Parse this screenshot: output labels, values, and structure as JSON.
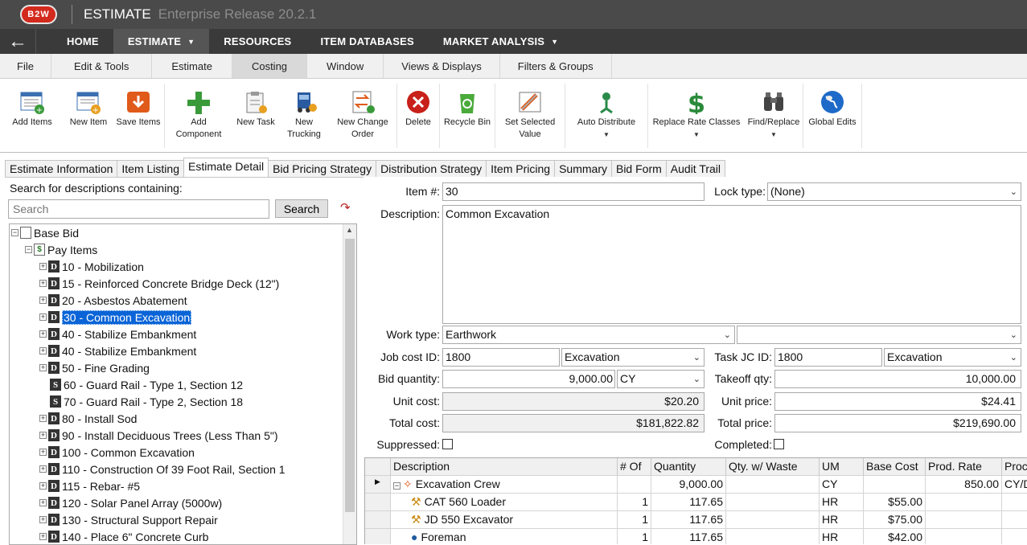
{
  "app": {
    "logo": "B2W",
    "title": "ESTIMATE",
    "release": "Enterprise Release 20.2.1"
  },
  "nav": {
    "home": "HOME",
    "estimate": "ESTIMATE",
    "resources": "RESOURCES",
    "item_db": "ITEM DATABASES",
    "market": "MARKET ANALYSIS"
  },
  "menu": [
    "File",
    "Edit & Tools",
    "Estimate",
    "Costing",
    "Window",
    "Views & Displays",
    "Filters & Groups"
  ],
  "ribbon": {
    "add_items": "Add Items",
    "new_item": "New Item",
    "save_items": "Save Items",
    "add_component_1": "Add",
    "add_component_2": "Component",
    "new_task": "New Task",
    "new_trucking_1": "New",
    "new_trucking_2": "Trucking",
    "new_change_1": "New Change",
    "new_change_2": "Order",
    "delete": "Delete",
    "recycle": "Recycle Bin",
    "set_selected_1": "Set Selected",
    "set_selected_2": "Value",
    "auto_distribute": "Auto Distribute",
    "replace_rate": "Replace Rate Classes",
    "find_replace": "Find/Replace",
    "global_edits": "Global Edits"
  },
  "tabs": [
    "Estimate Information",
    "Item Listing",
    "Estimate Detail",
    "Bid Pricing Strategy",
    "Distribution Strategy",
    "Item Pricing",
    "Summary",
    "Bid Form",
    "Audit Trail"
  ],
  "search": {
    "label": "Search for descriptions containing:",
    "placeholder": "Search",
    "button": "Search"
  },
  "tree": {
    "root": "Base Bid",
    "group": "Pay Items",
    "items": [
      "10 - Mobilization",
      "15 - Reinforced Concrete Bridge Deck (12\")",
      "20 - Asbestos Abatement",
      "30 - Common Excavation",
      "40 - Stabilize Embankment",
      "40 - Stabilize Embankment",
      "50 - Fine Grading",
      "60 - Guard Rail - Type 1, Section 12",
      "70 - Guard Rail - Type 2, Section 18",
      "80 - Install  Sod",
      "90 - Install Deciduous Trees (Less Than 5\")",
      "100 - Common Excavation",
      "110 - Construction Of 39 Foot Rail, Section 1",
      "115 - Rebar- #5",
      "120 - Solar Panel Array (5000w)",
      "130 - Structural Support Repair",
      "140 - Place 6\" Concrete Curb"
    ],
    "types": [
      "D",
      "D",
      "D",
      "D",
      "D",
      "D",
      "D",
      "S",
      "S",
      "D",
      "D",
      "D",
      "D",
      "D",
      "D",
      "D",
      "D"
    ]
  },
  "detail": {
    "item_no_label": "Item #:",
    "item_no": "30",
    "lock_label": "Lock type:",
    "lock": "(None)",
    "desc_label": "Description:",
    "desc": "Common Excavation",
    "work_label": "Work type:",
    "work": "Earthwork",
    "work2": "",
    "jc_label": "Job cost ID:",
    "jc": "1800",
    "jc_name": "Excavation",
    "tjc_label": "Task JC ID:",
    "tjc": "1800",
    "tjc_name": "Excavation",
    "bidqty_label": "Bid quantity:",
    "bidqty": "9,000.00",
    "uom": "CY",
    "takeoff_label": "Takeoff qty:",
    "takeoff": "10,000.00",
    "unitcost_label": "Unit cost:",
    "unitcost": "$20.20",
    "unitprice_label": "Unit price:",
    "unitprice": "$24.41",
    "totalcost_label": "Total cost:",
    "totalcost": "$181,822.82",
    "totalprice_label": "Total price:",
    "totalprice": "$219,690.00",
    "suppressed_label": "Suppressed:",
    "completed_label": "Completed:"
  },
  "grid": {
    "headers": [
      "Description",
      "# Of",
      "Quantity",
      "Qty. w/ Waste",
      "UM",
      "Base Cost",
      "Prod. Rate",
      "Proc"
    ],
    "rows": [
      {
        "desc": "Excavation Crew",
        "of": "",
        "qty": "9,000.00",
        "waste": "",
        "um": "CY",
        "base": "",
        "rate": "850.00",
        "proc": "CY/D"
      },
      {
        "desc": "CAT 560 Loader",
        "of": "1",
        "qty": "117.65",
        "waste": "",
        "um": "HR",
        "base": "$55.00",
        "rate": "",
        "proc": ""
      },
      {
        "desc": "JD 550 Excavator",
        "of": "1",
        "qty": "117.65",
        "waste": "",
        "um": "HR",
        "base": "$75.00",
        "rate": "",
        "proc": ""
      },
      {
        "desc": "Foreman",
        "of": "1",
        "qty": "117.65",
        "waste": "",
        "um": "HR",
        "base": "$42.00",
        "rate": "",
        "proc": ""
      }
    ]
  }
}
